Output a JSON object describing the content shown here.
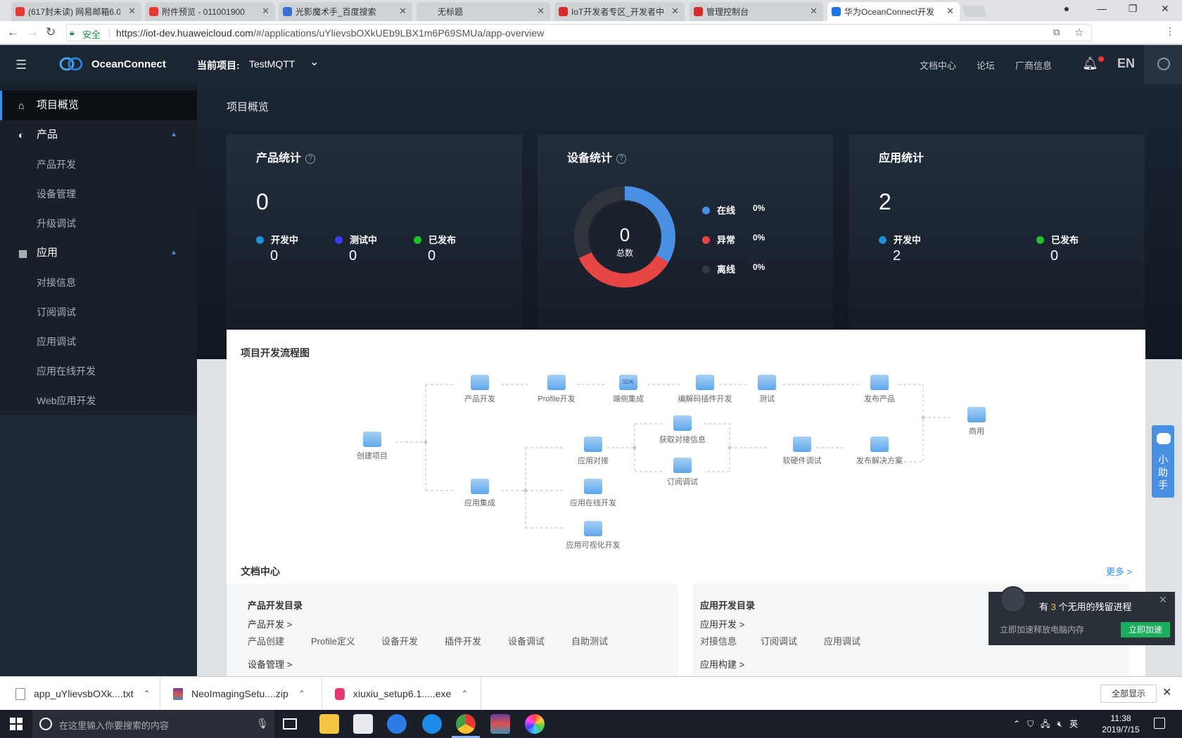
{
  "browser": {
    "tabs": [
      {
        "title": "(617封未读) 网易邮箱6.0",
        "color": "#e53935"
      },
      {
        "title": "附件预览 - 011001900",
        "color": "#e53935"
      },
      {
        "title": "光影魔术手_百度搜索",
        "color": "#3a6fd8"
      },
      {
        "title": "无标题",
        "color": ""
      },
      {
        "title": "IoT开发者专区_开发者中",
        "color": "#d32f2f"
      },
      {
        "title": "管理控制台",
        "color": "#d32f2f"
      },
      {
        "title": "华为OceanConnect开发",
        "color": "#1e73e8"
      }
    ],
    "secure_label": "安全",
    "url_host": "https://iot-dev.huaweicloud.com",
    "url_path": "/#/applications/uYlievsbOXkUEb9LBX1m6P69SMUa/app-overview"
  },
  "header": {
    "logo_text": "OceanConnect",
    "project_label": "当前项目:",
    "project_name": "TestMQTT",
    "links": [
      "文档中心",
      "论坛",
      "厂商信息"
    ],
    "lang": "EN"
  },
  "sidebar": {
    "items": [
      {
        "label": "项目概览",
        "level": "top",
        "icon": "home-icon",
        "active": true
      },
      {
        "label": "产品",
        "level": "top",
        "icon": "product-icon",
        "expanded": true
      },
      {
        "label": "产品开发",
        "level": "sub"
      },
      {
        "label": "设备管理",
        "level": "sub"
      },
      {
        "label": "升级调试",
        "level": "sub"
      },
      {
        "label": "应用",
        "level": "top",
        "icon": "grid-icon",
        "expanded": true
      },
      {
        "label": "对接信息",
        "level": "sub"
      },
      {
        "label": "订阅调试",
        "level": "sub"
      },
      {
        "label": "应用调试",
        "level": "sub"
      },
      {
        "label": "应用在线开发",
        "level": "sub"
      },
      {
        "label": "Web应用开发",
        "level": "sub"
      }
    ]
  },
  "overview": {
    "page_title": "项目概览",
    "product_stats": {
      "title": "产品统计",
      "total": "0",
      "legend": [
        {
          "label": "开发中",
          "value": "0",
          "color": "#1e90d6"
        },
        {
          "label": "测试中",
          "value": "0",
          "color": "#3b3ef0"
        },
        {
          "label": "已发布",
          "value": "0",
          "color": "#22c02a"
        }
      ]
    },
    "device_stats": {
      "title": "设备统计",
      "total": "0",
      "total_label": "总数",
      "legend": [
        {
          "label": "在线",
          "value": "0%",
          "color": "#4a90e2"
        },
        {
          "label": "异常",
          "value": "0%",
          "color": "#e84545"
        },
        {
          "label": "离线",
          "value": "0%",
          "color": "#333a44"
        }
      ]
    },
    "app_stats": {
      "title": "应用统计",
      "total": "2",
      "legend": [
        {
          "label": "开发中",
          "value": "2",
          "color": "#1e90d6"
        },
        {
          "label": "已发布",
          "value": "0",
          "color": "#22c02a"
        }
      ]
    }
  },
  "flow": {
    "title": "项目开发流程图",
    "nodes": {
      "create": "创建项目",
      "product_dev": "产品开发",
      "profile_dev": "Profile开发",
      "sdk": "端侧集成",
      "codec": "编解码插件开发",
      "test": "测试",
      "publish_product": "发布产品",
      "commercial": "商用",
      "app_integration": "应用集成",
      "app_connect": "应用对接",
      "app_online": "应用在线开发",
      "app_visual": "应用可视化开发",
      "get_info": "获取对接信息",
      "sub_debug": "订阅调试",
      "hw_debug": "软硬件调试",
      "publish_solution": "发布解决方案"
    },
    "sdk_icon_text": "SDK"
  },
  "docs": {
    "title": "文档中心",
    "more": "更多 >",
    "product_dir": {
      "title": "产品开发目录",
      "section1": "产品开发 >",
      "links1": [
        "产品创建",
        "Profile定义",
        "设备开发",
        "插件开发",
        "设备调试",
        "自助测试"
      ],
      "section2": "设备管理 >"
    },
    "app_dir": {
      "title": "应用开发目录",
      "section1": "应用开发 >",
      "links1": [
        "对接信息",
        "订阅调试",
        "应用调试"
      ],
      "section2": "应用构建 >"
    }
  },
  "helper": {
    "label": "小助手"
  },
  "popup": {
    "msg_pre": "有",
    "count": "3",
    "msg_post": "个无用的残留进程",
    "sub": "立即加速释放电脑内存",
    "button": "立即加速"
  },
  "downloads": {
    "items": [
      "app_uYlievsbOXk....txt",
      "NeoImagingSetu....zip",
      "xiuxiu_setup6.1.....exe"
    ],
    "show_all": "全部显示"
  },
  "taskbar": {
    "search_placeholder": "在这里输入你要搜索的内容",
    "ime": "英",
    "time": "11:38",
    "date": "2019/7/15"
  }
}
